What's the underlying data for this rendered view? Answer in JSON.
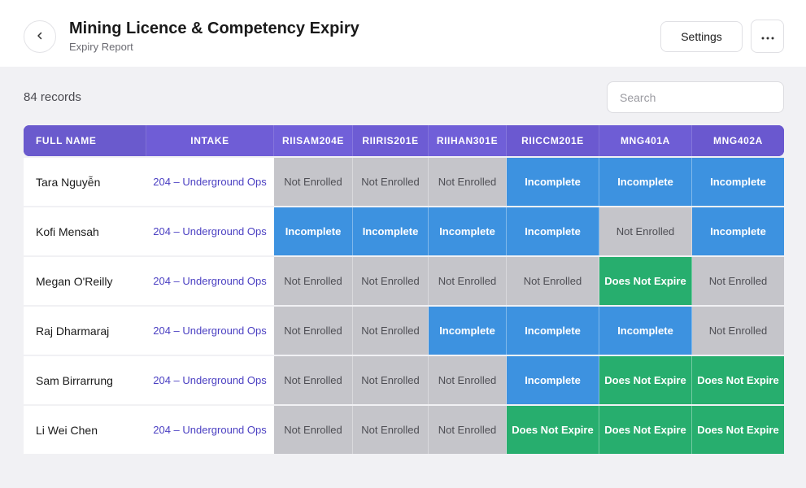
{
  "header": {
    "title": "Mining Licence & Competency Expiry",
    "subtitle": "Expiry Report",
    "settings_label": "Settings",
    "back_icon": "chevron-left-icon",
    "more_icon": "more-horizontal-icon"
  },
  "toolbar": {
    "record_count": "84 records",
    "search_placeholder": "Search"
  },
  "table": {
    "columns": [
      "FULL NAME",
      "INTAKE",
      "RIISAM204E",
      "RIIRIS201E",
      "RIIHAN301E",
      "RIICCM201E",
      "MNG401A",
      "MNG402A"
    ],
    "rows": [
      {
        "name": "Tara Nguyễn",
        "intake": "204 – Underground Ops",
        "statuses": [
          "Not Enrolled",
          "Not Enrolled",
          "Not Enrolled",
          "Incomplete",
          "Incomplete",
          "Incomplete"
        ]
      },
      {
        "name": "Kofi Mensah",
        "intake": "204 – Underground Ops",
        "statuses": [
          "Incomplete",
          "Incomplete",
          "Incomplete",
          "Incomplete",
          "Not Enrolled",
          "Incomplete"
        ]
      },
      {
        "name": "Megan O'Reilly",
        "intake": "204 – Underground Ops",
        "statuses": [
          "Not Enrolled",
          "Not Enrolled",
          "Not Enrolled",
          "Not Enrolled",
          "Does Not Expire",
          "Not Enrolled"
        ]
      },
      {
        "name": "Raj Dharmaraj",
        "intake": "204 – Underground Ops",
        "statuses": [
          "Not Enrolled",
          "Not Enrolled",
          "Incomplete",
          "Incomplete",
          "Incomplete",
          "Not Enrolled"
        ]
      },
      {
        "name": "Sam Birrarrung",
        "intake": "204 – Underground Ops",
        "statuses": [
          "Not Enrolled",
          "Not Enrolled",
          "Not Enrolled",
          "Incomplete",
          "Does Not Expire",
          "Does Not Expire"
        ]
      },
      {
        "name": "Li Wei Chen",
        "intake": "204 – Underground Ops",
        "statuses": [
          "Not Enrolled",
          "Not Enrolled",
          "Not Enrolled",
          "Does Not Expire",
          "Does Not Expire",
          "Does Not Expire"
        ]
      }
    ]
  },
  "status_colors": {
    "Not Enrolled": "#c5c5ca",
    "Incomplete": "#3d92e0",
    "Does Not Expire": "#27ae6e"
  }
}
